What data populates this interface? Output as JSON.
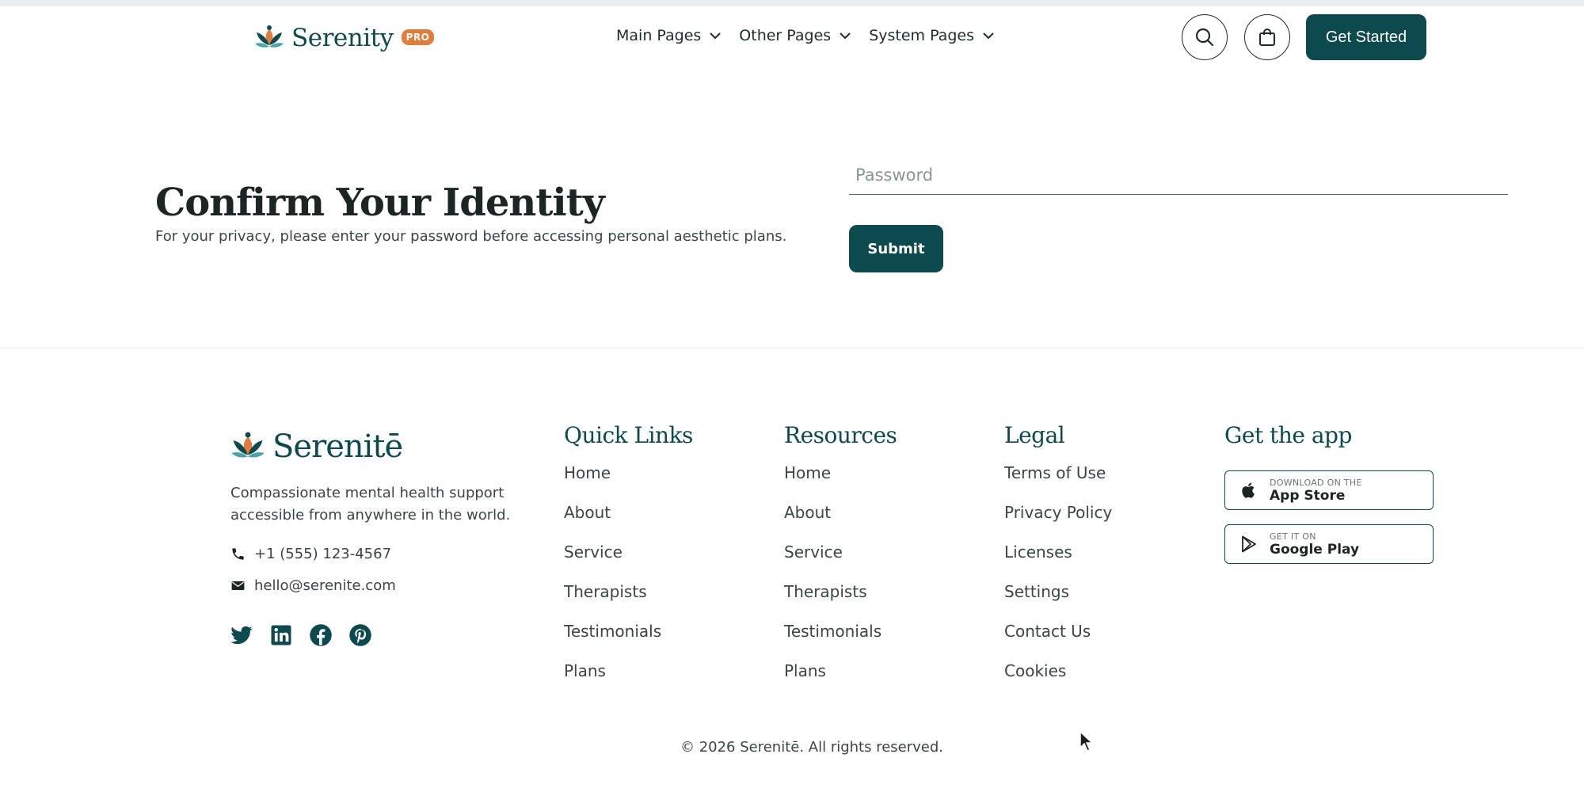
{
  "header": {
    "brand_name": "Serenity",
    "pro_badge": "PRO",
    "nav": [
      {
        "label": "Main Pages"
      },
      {
        "label": "Other Pages"
      },
      {
        "label": "System Pages"
      }
    ],
    "cta_label": "Get Started"
  },
  "main": {
    "title": "Confirm Your Identity",
    "subtitle": "For your privacy, please enter your password before accessing personal aesthetic plans.",
    "password_placeholder": "Password",
    "password_value": "",
    "submit_label": "Submit"
  },
  "footer": {
    "brand_name": "Serenitē",
    "tagline": "Compassionate mental health support accessible from anywhere in the world.",
    "phone": "+1 (555) 123-4567",
    "email": "hello@serenite.com",
    "social": [
      "twitter-icon",
      "linkedin-icon",
      "facebook-icon",
      "pinterest-icon"
    ],
    "columns": {
      "quick_links": {
        "title": "Quick Links",
        "items": [
          "Home",
          "About",
          "Service",
          "Therapists",
          "Testimonials",
          "Plans"
        ]
      },
      "resources": {
        "title": "Resources",
        "items": [
          "Home",
          "About",
          "Service",
          "Therapists",
          "Testimonials",
          "Plans"
        ]
      },
      "legal": {
        "title": "Legal",
        "items": [
          "Terms of Use",
          "Privacy Policy",
          "Licenses",
          "Settings",
          "Contact Us",
          "Cookies"
        ]
      },
      "app": {
        "title": "Get the app",
        "app_store": {
          "small": "DOWNLOAD ON THE",
          "big": "App Store"
        },
        "google_play": {
          "small": "GET IT ON",
          "big": "Google Play"
        }
      }
    },
    "copyright": "© 2026 Serenitē. All rights reserved."
  },
  "colors": {
    "primary": "#0c4a4e",
    "accent": "#e07c3c",
    "text": "#3b4545"
  }
}
